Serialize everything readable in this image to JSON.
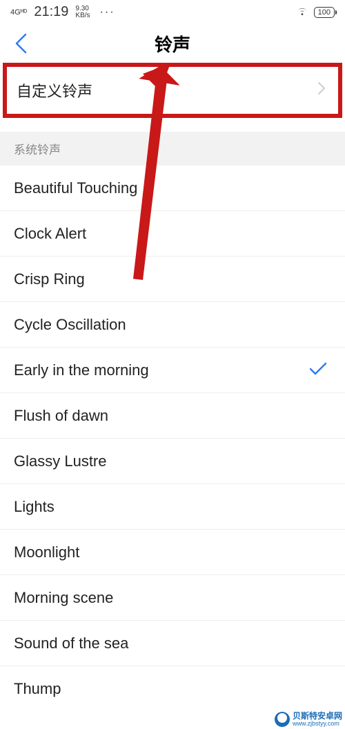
{
  "status": {
    "signal": "4Gᴴᴰ",
    "time": "21:19",
    "speed_value": "9.30",
    "speed_unit": "KB/s",
    "more": "···",
    "battery": "100"
  },
  "nav": {
    "title": "铃声"
  },
  "custom": {
    "label": "自定义铃声"
  },
  "section": {
    "header": "系统铃声"
  },
  "selected_index": 4,
  "ringtones": [
    {
      "label": "Beautiful Touching"
    },
    {
      "label": "Clock Alert"
    },
    {
      "label": "Crisp Ring"
    },
    {
      "label": "Cycle Oscillation"
    },
    {
      "label": "Early in the morning"
    },
    {
      "label": "Flush of dawn"
    },
    {
      "label": "Glassy Lustre"
    },
    {
      "label": "Lights"
    },
    {
      "label": "Moonlight"
    },
    {
      "label": "Morning scene"
    },
    {
      "label": "Sound of the sea"
    },
    {
      "label": "Thump"
    }
  ],
  "watermark": {
    "line1": "贝斯特安卓网",
    "line2": "www.zjbstyy.com"
  }
}
